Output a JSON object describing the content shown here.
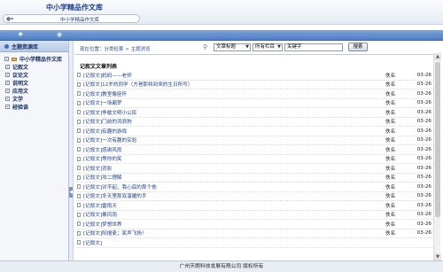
{
  "app": {
    "title": "中小学精品作文库"
  },
  "address": {
    "text": "中小学精品作文库"
  },
  "sidebar": {
    "header": "主题资源库",
    "root": "中小学精品作文库",
    "items": [
      {
        "label": "记叙文"
      },
      {
        "label": "议论文"
      },
      {
        "label": "说明文"
      },
      {
        "label": "应用文"
      },
      {
        "label": "文学"
      },
      {
        "label": "经验谈"
      }
    ]
  },
  "breadcrumb": {
    "prefix": "现在位置：",
    "part1": "分类检索",
    "sep": " > ",
    "part2": "主题浏览"
  },
  "search": {
    "field": "文章标题",
    "column": "所有栏目",
    "keyword": "关键字",
    "button": "搜索"
  },
  "list": {
    "title": "记叙文文章列表",
    "rows": [
      {
        "title": "[记叙文]妈妈——老师",
        "author": "佚名",
        "date": "03-26"
      },
      {
        "title": "[记叙文]12岁的同学（方爸那特到来的生日所写）",
        "author": "佚名",
        "date": "03-26"
      },
      {
        "title": "[记叙文]教室像座怀",
        "author": "佚名",
        "date": "03-26"
      },
      {
        "title": "[记叙文]一场霸罗",
        "author": "佚名",
        "date": "03-26"
      },
      {
        "title": "[记叙文]争敢文明小公民",
        "author": "佚名",
        "date": "03-26"
      },
      {
        "title": "[记叙文]门前的流浪狗",
        "author": "佚名",
        "date": "03-26"
      },
      {
        "title": "[记叙文]有趣的游戏",
        "author": "佚名",
        "date": "03-26"
      },
      {
        "title": "[记叙文]一次有趣的实验",
        "author": "佚名",
        "date": "03-26"
      },
      {
        "title": "[记叙文]感谢风雨",
        "author": "佚名",
        "date": "03-26"
      },
      {
        "title": "[记叙文]等你的笑",
        "author": "佚名",
        "date": "03-26"
      },
      {
        "title": "[记叙文]背影",
        "author": "佚名",
        "date": "03-26"
      },
      {
        "title": "[记叙文]攻二理解",
        "author": "佚名",
        "date": "03-26"
      },
      {
        "title": "[记叙文]对不起，我心底的那个他",
        "author": "佚名",
        "date": "03-26"
      },
      {
        "title": "[记叙文]冬天里那双温暖的手",
        "author": "佚名",
        "date": "03-26"
      },
      {
        "title": "[记叙文]雷雨天",
        "author": "佚名",
        "date": "03-26"
      },
      {
        "title": "[记叙文]暴风雨",
        "author": "佚名",
        "date": "03-26"
      },
      {
        "title": "[记叙文]梦想世界",
        "author": "佚名",
        "date": "03-26"
      },
      {
        "title": "[记叙文]阳搜麦；笑声飞扬！",
        "author": "佚名",
        "date": "03-26"
      },
      {
        "title": "[记叙文]",
        "author": "",
        "date": ""
      }
    ]
  },
  "footer": {
    "text": "广州天朗科技发展有限公司  版权所有"
  },
  "colors": {
    "accent": "#4f7ec3",
    "link": "#1c3f8b",
    "title": "#1c3d8f"
  }
}
